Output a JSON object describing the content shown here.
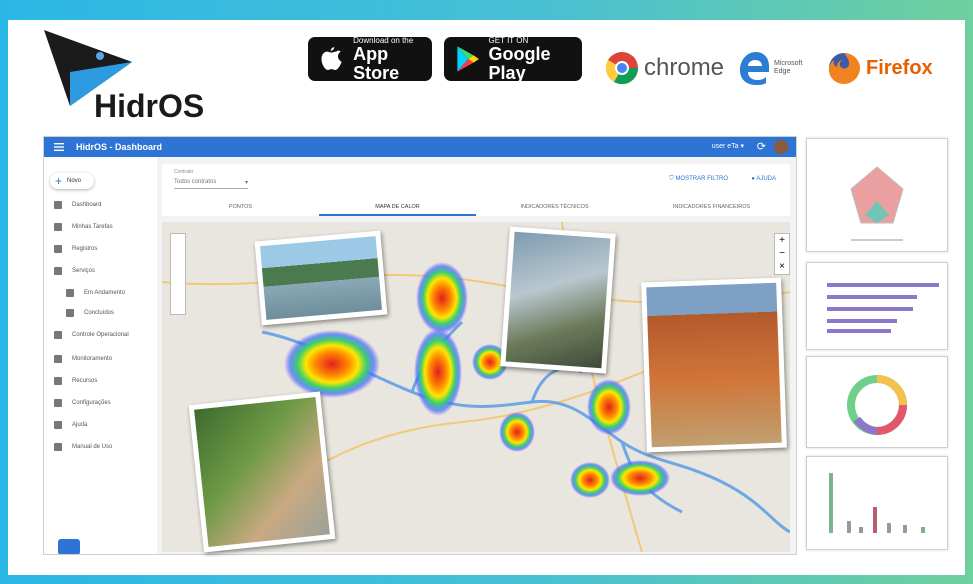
{
  "brand": {
    "name": "HidrOS",
    "colors": {
      "logo_dark": "#1b1b1b",
      "logo_blue": "#2e9be0",
      "appbar": "#2e74d4"
    }
  },
  "stores": [
    {
      "small": "Download on the",
      "big": "App Store",
      "icon": "apple-icon"
    },
    {
      "small": "GET IT ON",
      "big": "Google Play",
      "icon": "google-play-icon"
    }
  ],
  "browsers": [
    {
      "name": "chrome",
      "icon": "chrome-icon"
    },
    {
      "name": "Microsoft Edge",
      "icon": "edge-icon"
    },
    {
      "name": "Firefox",
      "icon": "firefox-icon"
    }
  ],
  "appbar": {
    "title": "HidrOS - Dashboard",
    "user": "user eTa ▾"
  },
  "sidebar": {
    "new_label": "Novo",
    "items": [
      {
        "label": "Dashboard"
      },
      {
        "label": "Minhas Tarefas"
      },
      {
        "label": "Registros"
      },
      {
        "label": "Serviços"
      },
      {
        "label": "Em Andamento",
        "sub": true
      },
      {
        "label": "Concluídos",
        "sub": true
      },
      {
        "label": "Controle Operacional"
      },
      {
        "label": "Monitoramento"
      },
      {
        "label": "Recursos"
      },
      {
        "label": "Configurações"
      },
      {
        "label": "Ajuda"
      },
      {
        "label": "Manual de Uso"
      }
    ]
  },
  "filter": {
    "select_label": "Contrato",
    "select_value": "Todos contratos",
    "more_filters": "MOSTRAR FILTRO",
    "help": "AJUDA"
  },
  "tabs": [
    "PONTOS",
    "MAPA DE CALOR",
    "INDICADORES TÉCNICOS",
    "INDICADORES FINANCEIROS"
  ]
}
